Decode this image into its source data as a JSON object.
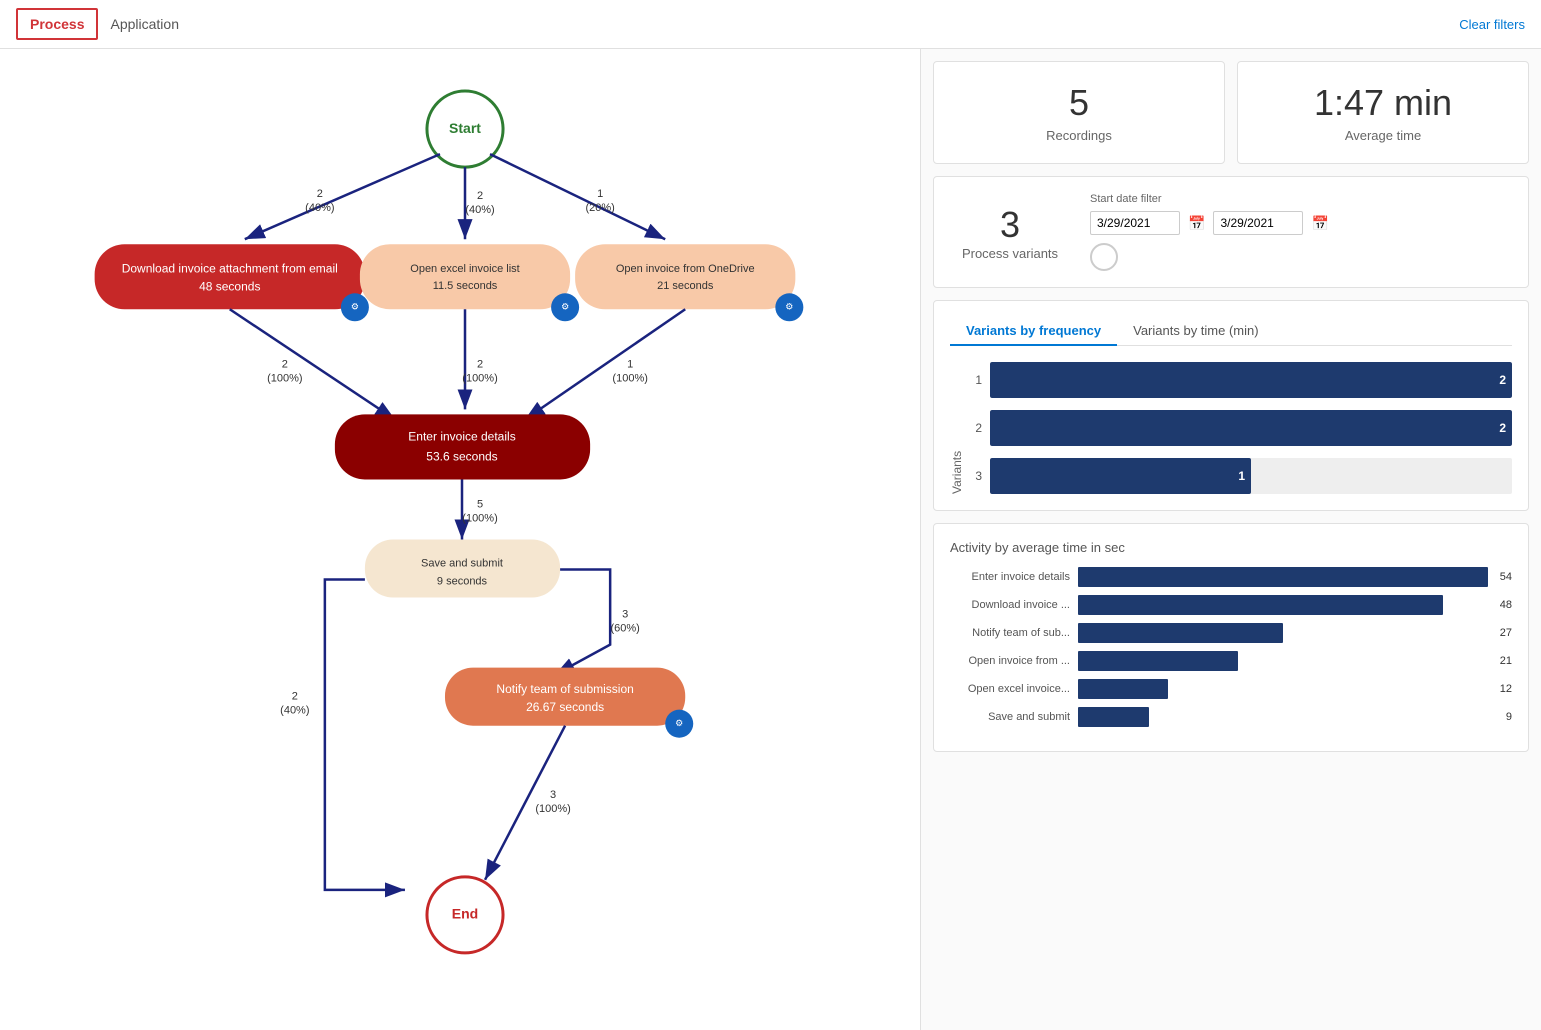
{
  "nav": {
    "tabs": [
      {
        "label": "Process",
        "active": true
      },
      {
        "label": "Application",
        "active": false
      }
    ],
    "clear_filters_label": "Clear filters"
  },
  "stats": {
    "recordings": {
      "value": "5",
      "label": "Recordings"
    },
    "average_time": {
      "value": "1:47 min",
      "label": "Average time"
    }
  },
  "process_variants": {
    "value": "3",
    "label": "Process variants"
  },
  "date_filter": {
    "label": "Start date filter",
    "from": "3/29/2021",
    "to": "3/29/2021"
  },
  "variants_chart": {
    "tab_frequency": "Variants by frequency",
    "tab_time": "Variants by time (min)",
    "y_axis_label": "Variants",
    "bars": [
      {
        "y_label": "1",
        "value": 2,
        "max": 2,
        "pct": 100
      },
      {
        "y_label": "2",
        "value": 2,
        "max": 2,
        "pct": 100
      },
      {
        "y_label": "3",
        "value": 1,
        "max": 2,
        "pct": 50
      }
    ]
  },
  "activity_chart": {
    "title": "Activity by average time in sec",
    "bars": [
      {
        "label": "Enter invoice details",
        "value": 54,
        "max": 54,
        "display": "54"
      },
      {
        "label": "Download invoice ...",
        "value": 48,
        "max": 54,
        "display": "48"
      },
      {
        "label": "Notify team of sub...",
        "value": 27,
        "max": 54,
        "display": "27"
      },
      {
        "label": "Open invoice from ...",
        "value": 21,
        "max": 54,
        "display": "21"
      },
      {
        "label": "Open excel invoice...",
        "value": 12,
        "max": 54,
        "display": "12"
      },
      {
        "label": "Save and submit",
        "value": 9,
        "max": 54,
        "display": "9"
      }
    ]
  },
  "flow": {
    "start_label": "Start",
    "end_label": "End",
    "nodes": {
      "download": {
        "line1": "Download invoice attachment from email",
        "line2": "48 seconds"
      },
      "open_excel": {
        "line1": "Open excel invoice list",
        "line2": "11.5 seconds"
      },
      "open_onedrive": {
        "line1": "Open invoice from OneDrive",
        "line2": "21 seconds"
      },
      "enter_invoice": {
        "line1": "Enter invoice details",
        "line2": "53.6 seconds"
      },
      "save_submit": {
        "line1": "Save and submit",
        "line2": "9 seconds"
      },
      "notify": {
        "line1": "Notify team of submission",
        "line2": "26.67 seconds"
      }
    },
    "edges": {
      "start_download": {
        "label": "2",
        "sublabel": "(40%)"
      },
      "start_excel": {
        "label": "2",
        "sublabel": "(40%)"
      },
      "start_onedrive": {
        "label": "1",
        "sublabel": "(20%)"
      },
      "download_enter": {
        "label": "2",
        "sublabel": "(100%)"
      },
      "excel_enter": {
        "label": "2",
        "sublabel": "(100%)"
      },
      "onedrive_enter": {
        "label": "1",
        "sublabel": "(100%)"
      },
      "enter_save": {
        "label": "5",
        "sublabel": "(100%)"
      },
      "save_notify": {
        "label": "3",
        "sublabel": "(60%)"
      },
      "save_end": {
        "label": "2",
        "sublabel": "(40%)"
      },
      "notify_end": {
        "label": "3",
        "sublabel": "(100%)"
      }
    }
  }
}
